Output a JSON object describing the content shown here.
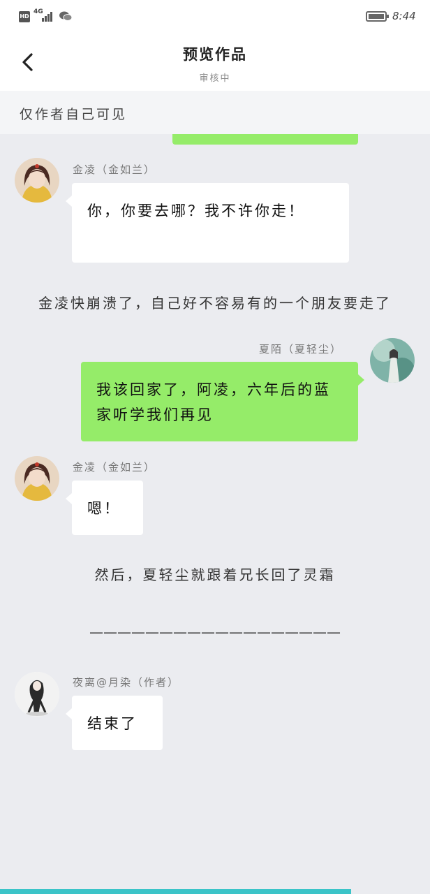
{
  "status_bar": {
    "hd": "HD",
    "network": "4G",
    "time": "8:44"
  },
  "header": {
    "title": "预览作品",
    "subtitle": "审核中"
  },
  "notice": "仅作者自己可见",
  "messages": [
    {
      "speaker": "金凌（金如兰）",
      "text": "你，你要去哪？我不许你走！",
      "side": "left"
    },
    {
      "narration": "金凌快崩溃了，自己好不容易有的一个朋友要走了"
    },
    {
      "speaker": "夏陌（夏轻尘）",
      "text": "我该回家了，阿凌，六年后的蓝家听学我们再见",
      "side": "right"
    },
    {
      "speaker": "金凌（金如兰）",
      "text": "嗯！",
      "side": "left"
    },
    {
      "narration": "然后，夏轻尘就跟着兄长回了灵霜"
    },
    {
      "narration": "——————————————————"
    },
    {
      "speaker": "夜离@月染（作者）",
      "text": "结束了",
      "side": "left"
    }
  ],
  "colors": {
    "green_bubble": "#95ec69",
    "background": "#ebecf0",
    "scrollbar": "#3bc4c8"
  }
}
